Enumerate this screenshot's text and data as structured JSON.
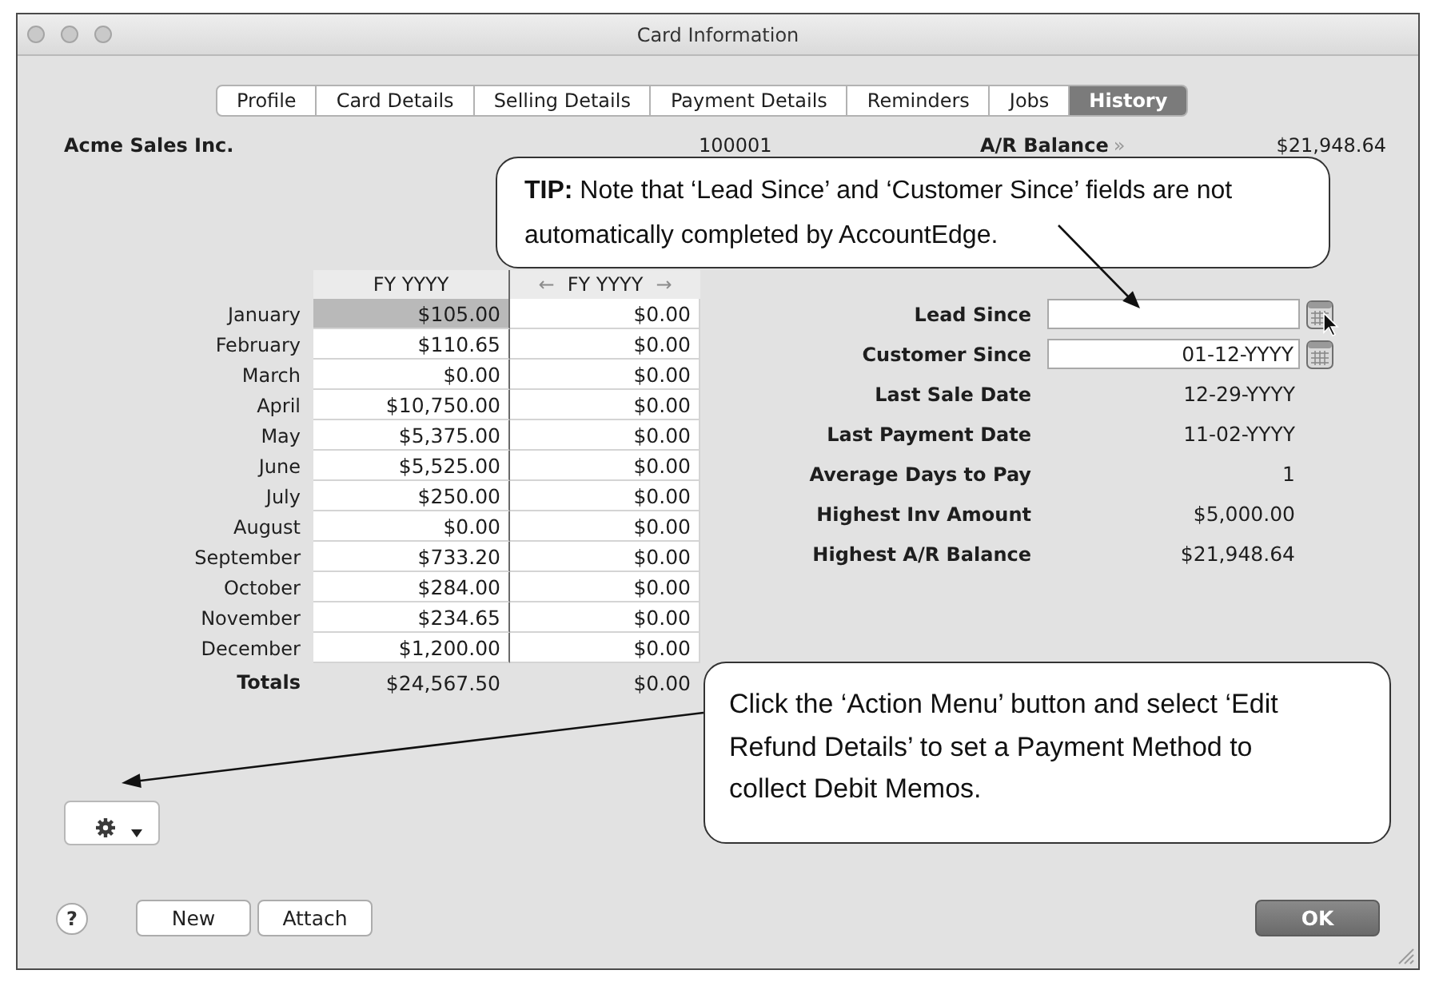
{
  "window": {
    "title": "Card Information"
  },
  "tabs": [
    {
      "label": "Profile",
      "selected": false
    },
    {
      "label": "Card Details",
      "selected": false
    },
    {
      "label": "Selling Details",
      "selected": false
    },
    {
      "label": "Payment Details",
      "selected": false
    },
    {
      "label": "Reminders",
      "selected": false
    },
    {
      "label": "Jobs",
      "selected": false
    },
    {
      "label": "History",
      "selected": true
    }
  ],
  "header": {
    "card_name": "Acme Sales Inc.",
    "card_id": "100001",
    "balance_label": "A/R Balance",
    "balance_link": "»",
    "balance": "$21,948.64"
  },
  "tip_callout": {
    "text": "**TIP:** Note that ‘Lead Since’ and ‘Customer Since’ fields are not automatically completed by AccountEdge."
  },
  "history_table": {
    "columns": [
      {
        "label": "FY YYYY"
      },
      {
        "label": "FY YYYY",
        "prev": "←",
        "next": "→"
      }
    ],
    "rows": [
      {
        "month": "January",
        "values": [
          "$105.00",
          "$0.00"
        ],
        "selected": true
      },
      {
        "month": "February",
        "values": [
          "$110.65",
          "$0.00"
        ],
        "selected": false
      },
      {
        "month": "March",
        "values": [
          "$0.00",
          "$0.00"
        ],
        "selected": false
      },
      {
        "month": "April",
        "values": [
          "$10,750.00",
          "$0.00"
        ],
        "selected": false
      },
      {
        "month": "May",
        "values": [
          "$5,375.00",
          "$0.00"
        ],
        "selected": false
      },
      {
        "month": "June",
        "values": [
          "$5,525.00",
          "$0.00"
        ],
        "selected": false
      },
      {
        "month": "July",
        "values": [
          "$250.00",
          "$0.00"
        ],
        "selected": false
      },
      {
        "month": "August",
        "values": [
          "$0.00",
          "$0.00"
        ],
        "selected": false
      },
      {
        "month": "September",
        "values": [
          "$733.20",
          "$0.00"
        ],
        "selected": false
      },
      {
        "month": "October",
        "values": [
          "$284.00",
          "$0.00"
        ],
        "selected": false
      },
      {
        "month": "November",
        "values": [
          "$234.65",
          "$0.00"
        ],
        "selected": false
      },
      {
        "month": "December",
        "values": [
          "$1,200.00",
          "$0.00"
        ],
        "selected": false
      }
    ],
    "totals": {
      "label": "Totals",
      "values": [
        "$24,567.50",
        "$0.00"
      ]
    }
  },
  "dates": [
    {
      "label": "Lead Since",
      "kind": "date_field"
    },
    {
      "label": "Customer Since",
      "kind": "date_field",
      "value": "01-12-YYYY"
    },
    {
      "label": "Last Sale Date",
      "kind": "readout",
      "value": "12-29-YYYY"
    },
    {
      "label": "Last Payment Date",
      "kind": "readout",
      "value": "11-02-YYYY"
    },
    {
      "label": "Average Days to Pay",
      "kind": "readout",
      "value": "1"
    },
    {
      "label": "Highest Inv Amount",
      "kind": "readout",
      "value": "$5,000.00"
    },
    {
      "label": "Highest A/R Balance",
      "kind": "readout",
      "value": "$21,948.64"
    }
  ],
  "action_callout": {
    "text": "Click the ‘Action Menu’ button and select ‘Edit Refund Details’ to set a Payment Method to collect Debit Memos."
  },
  "footer": {
    "help": "?",
    "buttons_left": [
      {
        "label": "New",
        "default": false
      },
      {
        "label": "Attach",
        "default": false
      }
    ],
    "buttons_right": [
      {
        "label": "OK",
        "default": true
      }
    ]
  }
}
